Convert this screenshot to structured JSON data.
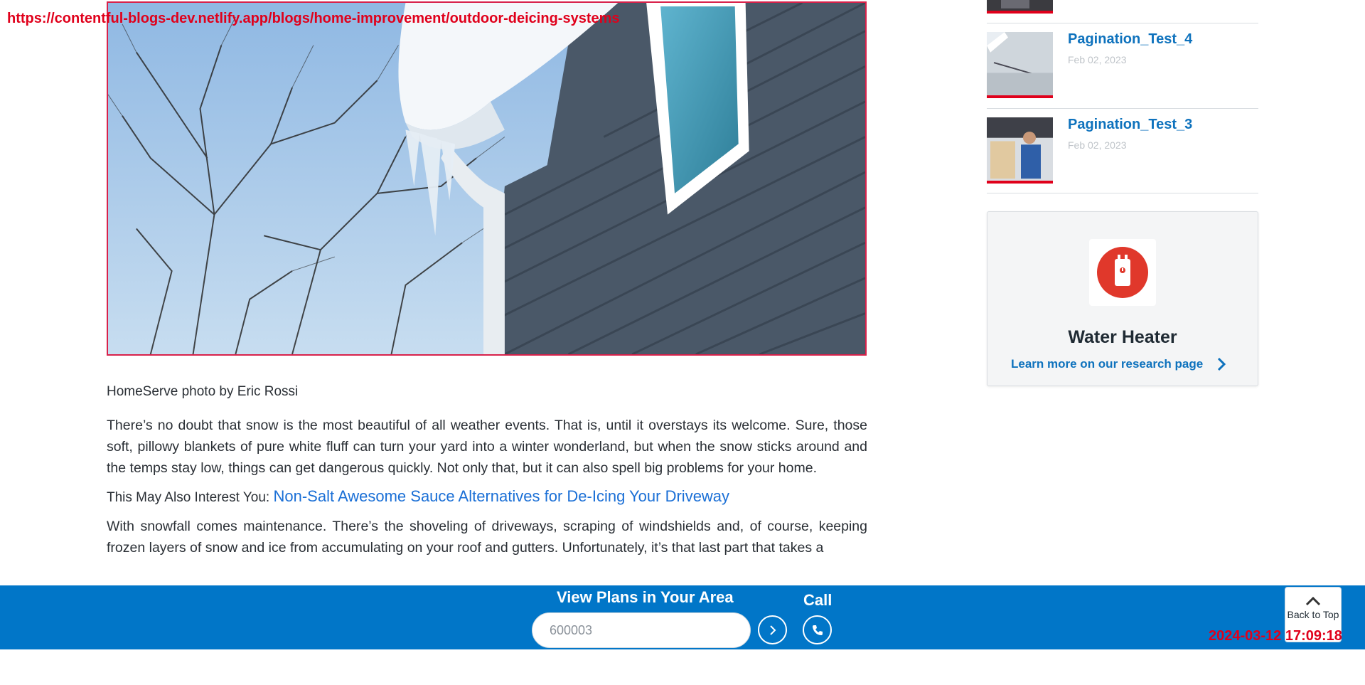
{
  "overlay": {
    "url": "https://contentful-blogs-dev.netlify.app/blogs/home-improvement/outdoor-deicing-systems",
    "timestamp": "2024-03-12 17:09:18"
  },
  "article": {
    "caption": "HomeServe photo by Eric Rossi",
    "paragraph1": "There’s no doubt that snow is the most beautiful of all weather events. That is, until it overstays its welcome. Sure, those soft, pillowy blankets of pure white fluff can turn your yard into a winter wonderland, but when the snow sticks around and the temps stay low, things can get dangerous quickly. Not only that, but it can also spell big problems for your home.",
    "interest_label": "This May Also Interest You:",
    "interest_link": "Non-Salt Awesome Sauce Alternatives for De-Icing Your Driveway",
    "paragraph2": "With snowfall comes maintenance. There’s the shoveling of driveways, scraping of windshields and, of course, keeping frozen layers of snow and ice from accumulating on your roof and gutters. Unfortunately, it’s that last part that takes a"
  },
  "sidebar": {
    "posts": [
      {
        "title": "Pagination_Test_4",
        "date": "Feb 02, 2023"
      },
      {
        "title": "Pagination_Test_3",
        "date": "Feb 02, 2023"
      }
    ],
    "promo": {
      "title": "Water Heater",
      "link": "Learn more on our research page"
    }
  },
  "bottom_bar": {
    "heading": "View Plans in Your Area",
    "zip_placeholder": "600003",
    "call_label": "Call",
    "back_to_top": "Back to Top"
  },
  "colors": {
    "brand_blue": "#0176c8",
    "link_blue": "#0e72bd",
    "accent_red": "#e0001b"
  }
}
